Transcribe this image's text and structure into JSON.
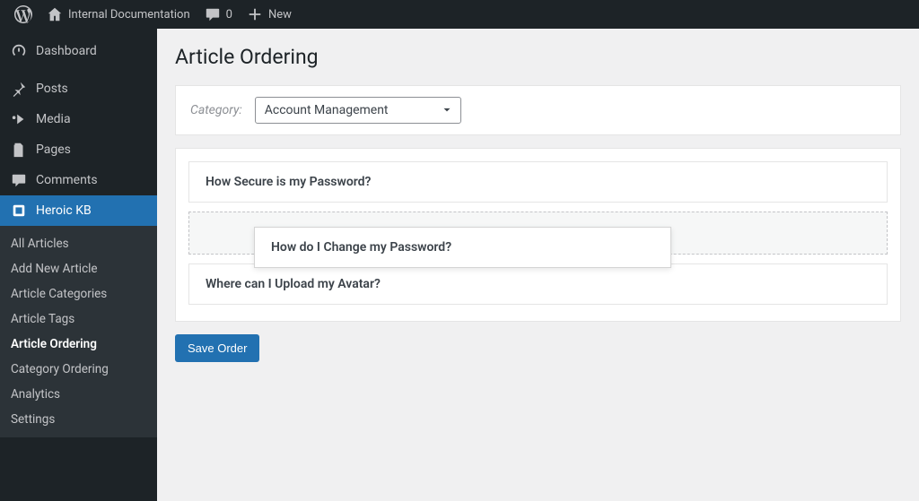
{
  "adminbar": {
    "site_title": "Internal Documentation",
    "comments_count": "0",
    "new_label": "New"
  },
  "sidebar": {
    "dashboard": "Dashboard",
    "posts": "Posts",
    "media": "Media",
    "pages": "Pages",
    "comments": "Comments",
    "heroic_kb": "Heroic KB",
    "submenu": {
      "all_articles": "All Articles",
      "add_new": "Add New Article",
      "categories": "Article Categories",
      "tags": "Article Tags",
      "article_ordering": "Article Ordering",
      "category_ordering": "Category Ordering",
      "analytics": "Analytics",
      "settings": "Settings"
    }
  },
  "main": {
    "title": "Article Ordering",
    "category_label": "Category:",
    "category_selected": "Account Management",
    "articles": {
      "0": "How Secure is my Password?",
      "1": "How do I Change my Password?",
      "2": "Where can I Upload my Avatar?"
    },
    "save_button": "Save Order"
  }
}
